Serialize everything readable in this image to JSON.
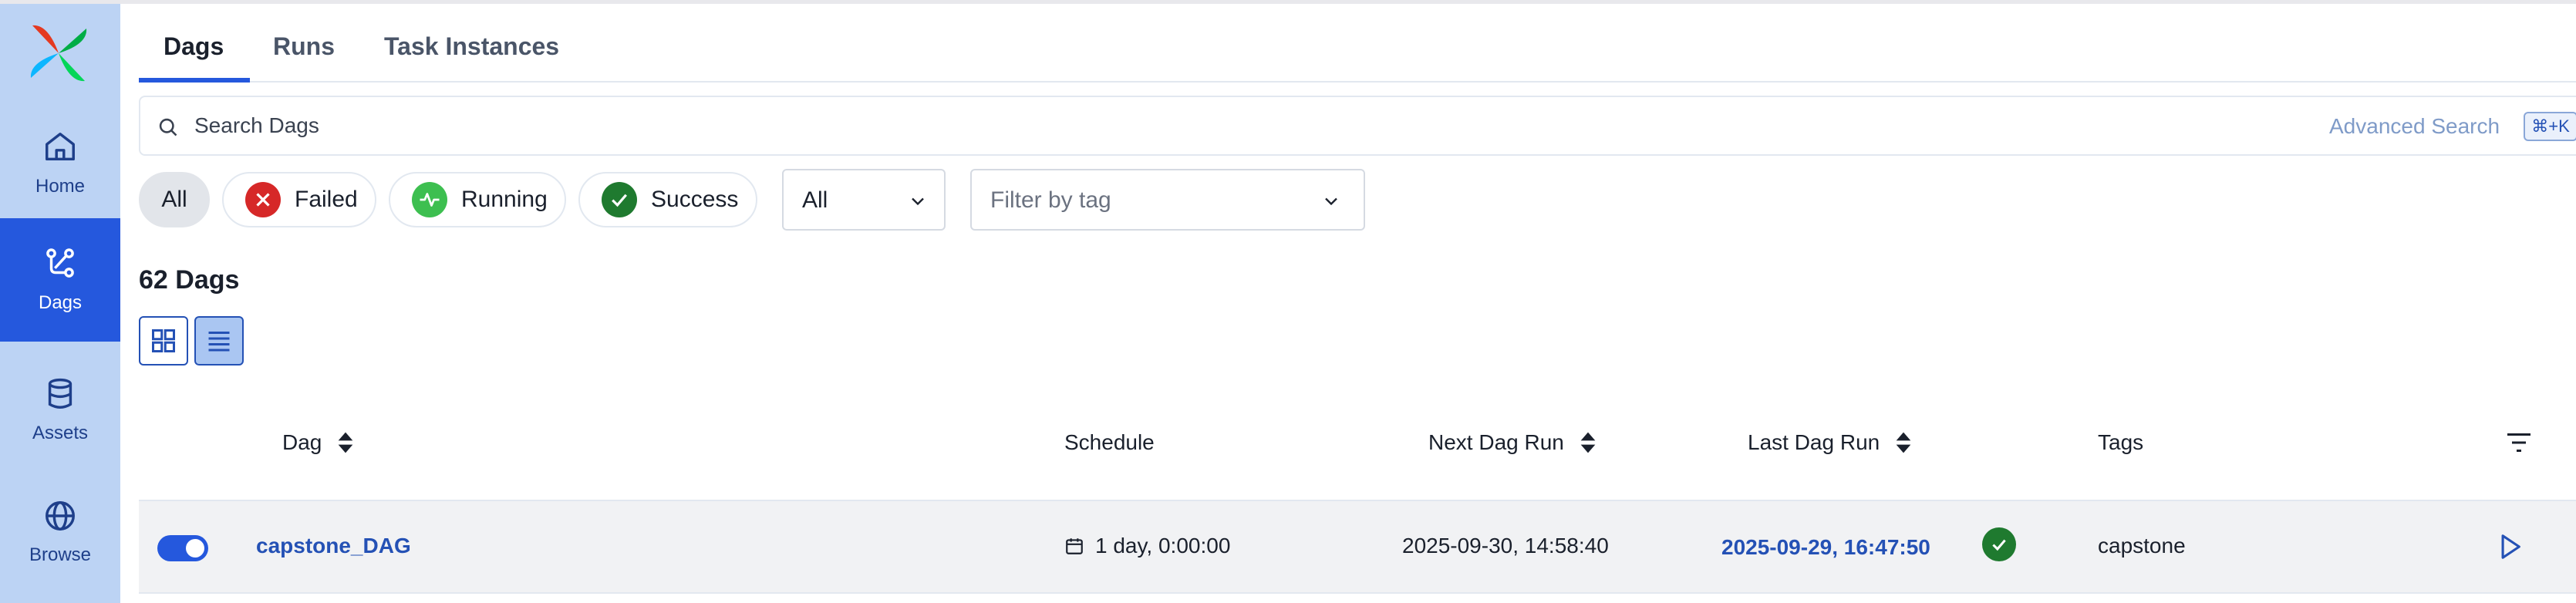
{
  "sidebar": {
    "items": [
      {
        "label": "Home",
        "icon": "home-icon"
      },
      {
        "label": "Dags",
        "icon": "dags-icon",
        "active": true
      },
      {
        "label": "Assets",
        "icon": "database-icon"
      },
      {
        "label": "Browse",
        "icon": "globe-icon"
      }
    ]
  },
  "tabs": [
    {
      "label": "Dags",
      "active": true
    },
    {
      "label": "Runs"
    },
    {
      "label": "Task Instances"
    }
  ],
  "search": {
    "placeholder": "Search Dags",
    "advanced_label": "Advanced Search",
    "shortcut": "⌘+K"
  },
  "filters": {
    "all_label": "All",
    "failed_label": "Failed",
    "running_label": "Running",
    "success_label": "Success",
    "type_select_value": "All",
    "tag_placeholder": "Filter by tag"
  },
  "dag_count": "62 Dags",
  "table": {
    "columns": {
      "dag": "Dag",
      "schedule": "Schedule",
      "next_run": "Next Dag Run",
      "last_run": "Last Dag Run",
      "tags": "Tags"
    },
    "rows": [
      {
        "enabled": true,
        "dag": "capstone_DAG",
        "schedule": "1 day, 0:00:00",
        "next_run": "2025-09-30, 14:58:40",
        "last_run": "2025-09-29, 16:47:50",
        "last_run_state": "success",
        "tags": "capstone"
      }
    ]
  },
  "colors": {
    "sidebar_bg": "#bcd3f4",
    "accent": "#2558dd",
    "failed": "#d62828",
    "running": "#3dbf50",
    "success": "#1f7a2f"
  }
}
